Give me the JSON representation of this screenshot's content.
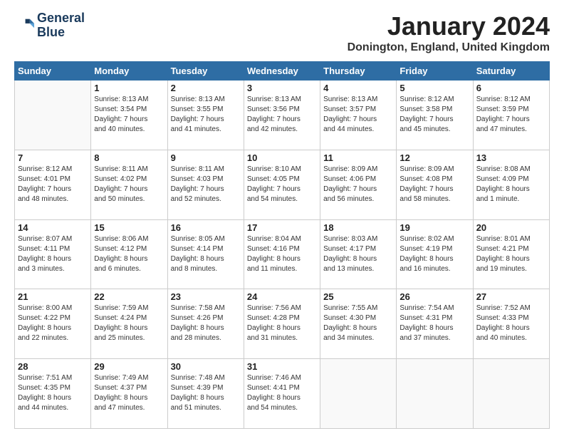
{
  "logo": {
    "line1": "General",
    "line2": "Blue"
  },
  "title": "January 2024",
  "location": "Donington, England, United Kingdom",
  "days_header": [
    "Sunday",
    "Monday",
    "Tuesday",
    "Wednesday",
    "Thursday",
    "Friday",
    "Saturday"
  ],
  "weeks": [
    [
      {
        "day": "",
        "info": ""
      },
      {
        "day": "1",
        "info": "Sunrise: 8:13 AM\nSunset: 3:54 PM\nDaylight: 7 hours\nand 40 minutes."
      },
      {
        "day": "2",
        "info": "Sunrise: 8:13 AM\nSunset: 3:55 PM\nDaylight: 7 hours\nand 41 minutes."
      },
      {
        "day": "3",
        "info": "Sunrise: 8:13 AM\nSunset: 3:56 PM\nDaylight: 7 hours\nand 42 minutes."
      },
      {
        "day": "4",
        "info": "Sunrise: 8:13 AM\nSunset: 3:57 PM\nDaylight: 7 hours\nand 44 minutes."
      },
      {
        "day": "5",
        "info": "Sunrise: 8:12 AM\nSunset: 3:58 PM\nDaylight: 7 hours\nand 45 minutes."
      },
      {
        "day": "6",
        "info": "Sunrise: 8:12 AM\nSunset: 3:59 PM\nDaylight: 7 hours\nand 47 minutes."
      }
    ],
    [
      {
        "day": "7",
        "info": "Sunrise: 8:12 AM\nSunset: 4:01 PM\nDaylight: 7 hours\nand 48 minutes."
      },
      {
        "day": "8",
        "info": "Sunrise: 8:11 AM\nSunset: 4:02 PM\nDaylight: 7 hours\nand 50 minutes."
      },
      {
        "day": "9",
        "info": "Sunrise: 8:11 AM\nSunset: 4:03 PM\nDaylight: 7 hours\nand 52 minutes."
      },
      {
        "day": "10",
        "info": "Sunrise: 8:10 AM\nSunset: 4:05 PM\nDaylight: 7 hours\nand 54 minutes."
      },
      {
        "day": "11",
        "info": "Sunrise: 8:09 AM\nSunset: 4:06 PM\nDaylight: 7 hours\nand 56 minutes."
      },
      {
        "day": "12",
        "info": "Sunrise: 8:09 AM\nSunset: 4:08 PM\nDaylight: 7 hours\nand 58 minutes."
      },
      {
        "day": "13",
        "info": "Sunrise: 8:08 AM\nSunset: 4:09 PM\nDaylight: 8 hours\nand 1 minute."
      }
    ],
    [
      {
        "day": "14",
        "info": "Sunrise: 8:07 AM\nSunset: 4:11 PM\nDaylight: 8 hours\nand 3 minutes."
      },
      {
        "day": "15",
        "info": "Sunrise: 8:06 AM\nSunset: 4:12 PM\nDaylight: 8 hours\nand 6 minutes."
      },
      {
        "day": "16",
        "info": "Sunrise: 8:05 AM\nSunset: 4:14 PM\nDaylight: 8 hours\nand 8 minutes."
      },
      {
        "day": "17",
        "info": "Sunrise: 8:04 AM\nSunset: 4:16 PM\nDaylight: 8 hours\nand 11 minutes."
      },
      {
        "day": "18",
        "info": "Sunrise: 8:03 AM\nSunset: 4:17 PM\nDaylight: 8 hours\nand 13 minutes."
      },
      {
        "day": "19",
        "info": "Sunrise: 8:02 AM\nSunset: 4:19 PM\nDaylight: 8 hours\nand 16 minutes."
      },
      {
        "day": "20",
        "info": "Sunrise: 8:01 AM\nSunset: 4:21 PM\nDaylight: 8 hours\nand 19 minutes."
      }
    ],
    [
      {
        "day": "21",
        "info": "Sunrise: 8:00 AM\nSunset: 4:22 PM\nDaylight: 8 hours\nand 22 minutes."
      },
      {
        "day": "22",
        "info": "Sunrise: 7:59 AM\nSunset: 4:24 PM\nDaylight: 8 hours\nand 25 minutes."
      },
      {
        "day": "23",
        "info": "Sunrise: 7:58 AM\nSunset: 4:26 PM\nDaylight: 8 hours\nand 28 minutes."
      },
      {
        "day": "24",
        "info": "Sunrise: 7:56 AM\nSunset: 4:28 PM\nDaylight: 8 hours\nand 31 minutes."
      },
      {
        "day": "25",
        "info": "Sunrise: 7:55 AM\nSunset: 4:30 PM\nDaylight: 8 hours\nand 34 minutes."
      },
      {
        "day": "26",
        "info": "Sunrise: 7:54 AM\nSunset: 4:31 PM\nDaylight: 8 hours\nand 37 minutes."
      },
      {
        "day": "27",
        "info": "Sunrise: 7:52 AM\nSunset: 4:33 PM\nDaylight: 8 hours\nand 40 minutes."
      }
    ],
    [
      {
        "day": "28",
        "info": "Sunrise: 7:51 AM\nSunset: 4:35 PM\nDaylight: 8 hours\nand 44 minutes."
      },
      {
        "day": "29",
        "info": "Sunrise: 7:49 AM\nSunset: 4:37 PM\nDaylight: 8 hours\nand 47 minutes."
      },
      {
        "day": "30",
        "info": "Sunrise: 7:48 AM\nSunset: 4:39 PM\nDaylight: 8 hours\nand 51 minutes."
      },
      {
        "day": "31",
        "info": "Sunrise: 7:46 AM\nSunset: 4:41 PM\nDaylight: 8 hours\nand 54 minutes."
      },
      {
        "day": "",
        "info": ""
      },
      {
        "day": "",
        "info": ""
      },
      {
        "day": "",
        "info": ""
      }
    ]
  ]
}
